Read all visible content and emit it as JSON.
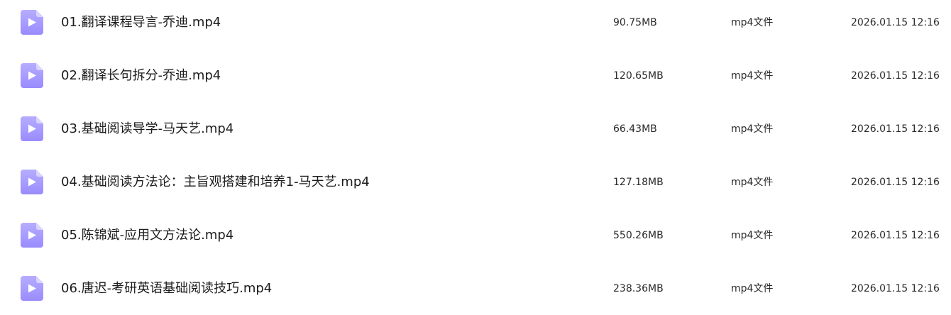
{
  "colors": {
    "icon_start": "#b3aaff",
    "icon_end": "#9c8cff",
    "text": "#1b1b1b"
  },
  "files": [
    {
      "icon": "video-file-icon",
      "name": "01.翻译课程导言-乔迪.mp4",
      "size": "90.75MB",
      "type": "mp4文件",
      "date": "2026.01.15 12:16"
    },
    {
      "icon": "video-file-icon",
      "name": "02.翻译长句拆分-乔迪.mp4",
      "size": "120.65MB",
      "type": "mp4文件",
      "date": "2026.01.15 12:16"
    },
    {
      "icon": "video-file-icon",
      "name": "03.基础阅读导学-马天艺.mp4",
      "size": "66.43MB",
      "type": "mp4文件",
      "date": "2026.01.15 12:16"
    },
    {
      "icon": "video-file-icon",
      "name": "04.基础阅读方法论：主旨观搭建和培养1-马天艺.mp4",
      "size": "127.18MB",
      "type": "mp4文件",
      "date": "2026.01.15 12:16"
    },
    {
      "icon": "video-file-icon",
      "name": "05.陈锦斌-应用文方法论.mp4",
      "size": "550.26MB",
      "type": "mp4文件",
      "date": "2026.01.15 12:16"
    },
    {
      "icon": "video-file-icon",
      "name": "06.唐迟-考研英语基础阅读技巧.mp4",
      "size": "238.36MB",
      "type": "mp4文件",
      "date": "2026.01.15 12:16"
    }
  ]
}
